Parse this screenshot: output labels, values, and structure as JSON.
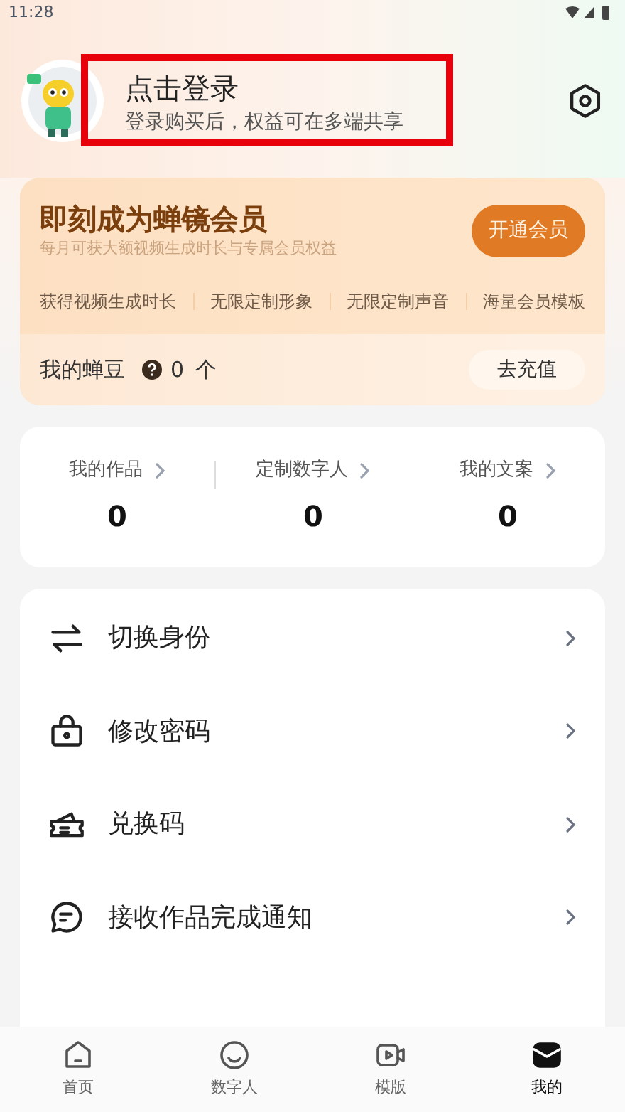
{
  "status_bar": {
    "time": "11:28"
  },
  "profile": {
    "name": "点击登录",
    "subtitle": "登录购买后，权益可在多端共享",
    "highlighted": true
  },
  "membership": {
    "title": "即刻成为蝉镜会员",
    "subtitle": "每月可获大额视频生成时长与专属会员权益",
    "button": "开通会员",
    "benefits": [
      "获得视频生成时长",
      "无限定制形象",
      "无限定制声音",
      "海量会员模板"
    ],
    "beans_label": "我的蝉豆",
    "beans_count": "0",
    "beans_unit": "个",
    "recharge_button": "去充值"
  },
  "stats": [
    {
      "label": "我的作品",
      "value": "0"
    },
    {
      "label": "定制数字人",
      "value": "0"
    },
    {
      "label": "我的文案",
      "value": "0"
    }
  ],
  "menu": [
    {
      "kind": "switch",
      "label": "切换身份"
    },
    {
      "kind": "lock",
      "label": "修改密码"
    },
    {
      "kind": "ticket",
      "label": "兑换码"
    },
    {
      "kind": "message",
      "label": "接收作品完成通知"
    }
  ],
  "tab_bar": [
    {
      "kind": "home",
      "label": "首页",
      "selected": false
    },
    {
      "kind": "avatar",
      "label": "数字人",
      "selected": false
    },
    {
      "kind": "template",
      "label": "模版",
      "selected": false
    },
    {
      "kind": "mine",
      "label": "我的",
      "selected": true
    }
  ]
}
